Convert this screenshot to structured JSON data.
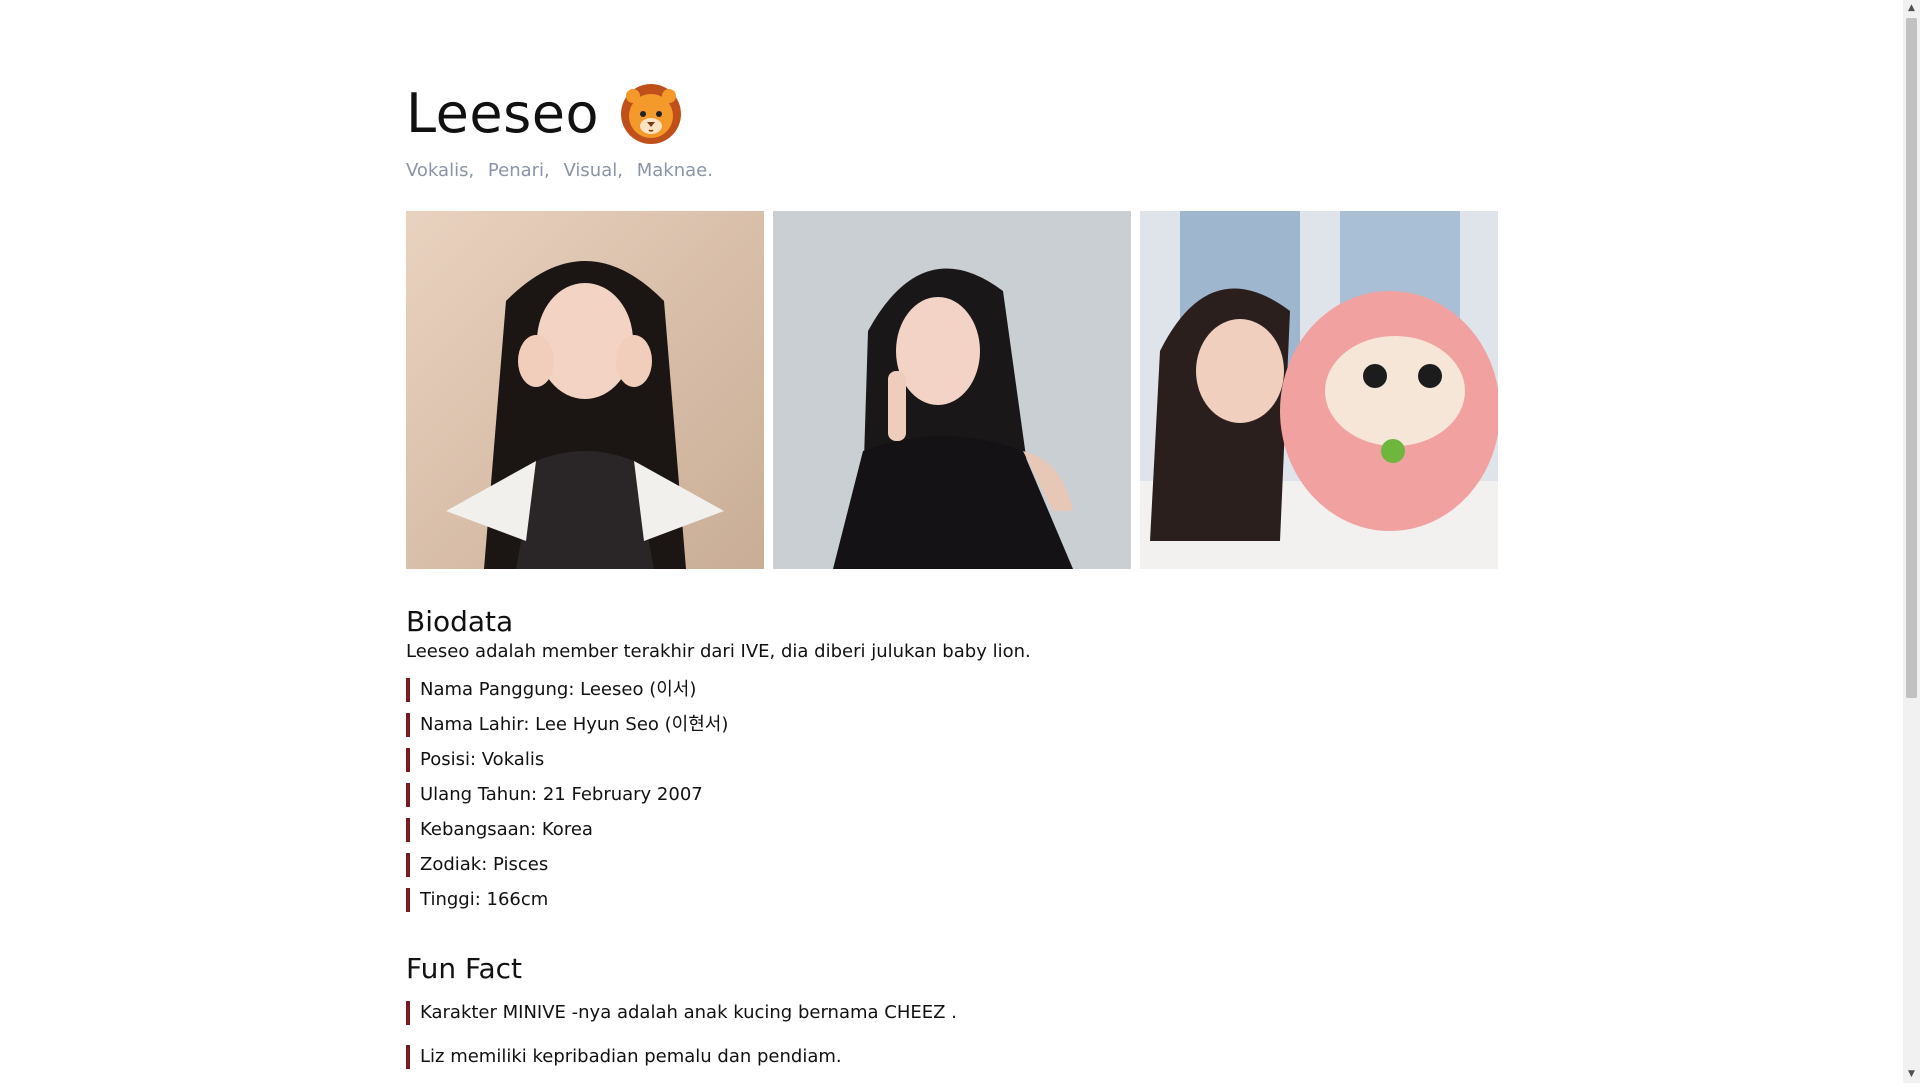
{
  "profile": {
    "name": "Leeseo",
    "emoji": "lion-face-icon",
    "roles": [
      "Vokalis,",
      "Penari,",
      "Visual,",
      "Maknae."
    ]
  },
  "gallery": {
    "photos": [
      {
        "name": "leeseo-photo-1"
      },
      {
        "name": "leeseo-photo-2"
      },
      {
        "name": "leeseo-photo-3"
      }
    ]
  },
  "biodata": {
    "heading": "Biodata",
    "intro": "Leeseo adalah member terakhir dari IVE, dia diberi julukan baby lion.",
    "facts": [
      "Nama Panggung: Leeseo (이서)",
      "Nama Lahir: Lee Hyun Seo (이현서)",
      "Posisi: Vokalis",
      "Ulang Tahun: 21 February 2007",
      "Kebangsaan: Korea",
      "Zodiak: Pisces",
      "Tinggi: 166cm"
    ]
  },
  "funfact": {
    "heading": "Fun Fact",
    "items": [
      "Karakter MINIVE -nya adalah anak kucing bernama CHEEZ .",
      "Liz memiliki kepribadian pemalu dan pendiam."
    ]
  },
  "colors": {
    "accent_bar": "#7a1b22",
    "roles_text": "#8a94a6"
  }
}
